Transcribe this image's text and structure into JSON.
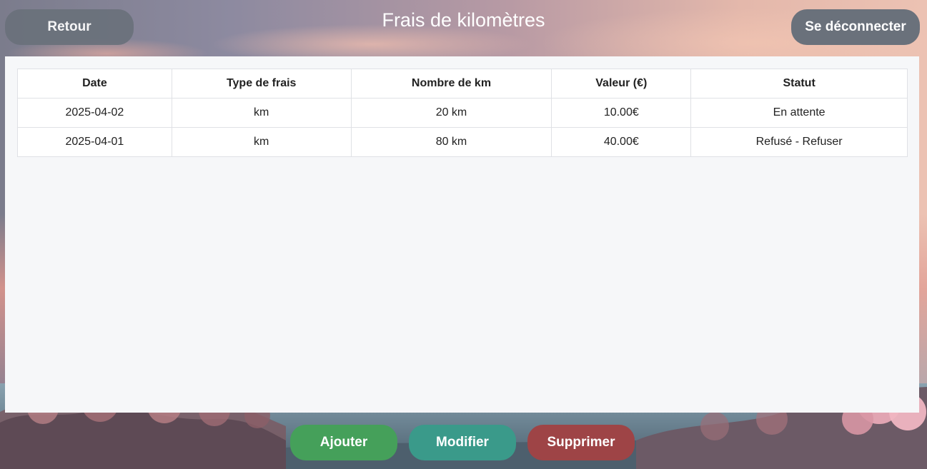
{
  "header": {
    "title": "Frais de kilomètres",
    "back_label": "Retour",
    "logout_label": "Se déconnecter"
  },
  "table": {
    "columns": [
      "Date",
      "Type de frais",
      "Nombre de km",
      "Valeur (€)",
      "Statut"
    ],
    "rows": [
      [
        "2025-04-02",
        "km",
        "20 km",
        "10.00€",
        "En attente"
      ],
      [
        "2025-04-01",
        "km",
        "80 km",
        "40.00€",
        "Refusé - Refuser"
      ]
    ]
  },
  "actions": {
    "add_label": "Ajouter",
    "edit_label": "Modifier",
    "delete_label": "Supprimer"
  },
  "colors": {
    "back_button": "#6a717b",
    "add_button": "#45a05a",
    "edit_button": "#3a9a8a",
    "delete_button": "#9e4446",
    "panel": "#f6f7f9"
  }
}
